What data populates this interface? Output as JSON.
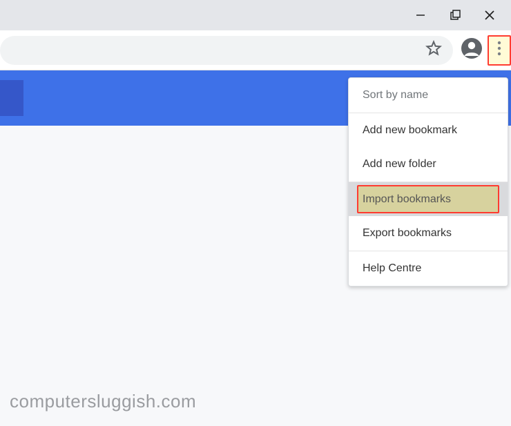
{
  "window_controls": {
    "minimize": "minimize",
    "maximize": "maximize",
    "close": "close"
  },
  "toolbar": {
    "star": "star",
    "profile": "profile",
    "more": "more"
  },
  "menu": {
    "sort": "Sort by name",
    "add_bookmark": "Add new bookmark",
    "add_folder": "Add new folder",
    "import": "Import bookmarks",
    "export": "Export bookmarks",
    "help": "Help Centre"
  },
  "watermark": "computersluggish.com"
}
